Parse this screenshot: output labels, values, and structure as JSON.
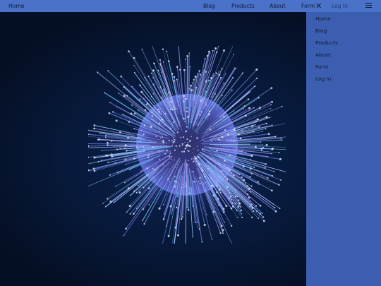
{
  "nav": {
    "home": "Home",
    "blog": "Blog",
    "products": "Products",
    "about": "About",
    "form": "Form",
    "login": "Log In",
    "close_icon": "close-icon",
    "menu_icon": "hamburger-menu-icon"
  },
  "drawer": {
    "items": [
      "Home",
      "Blog",
      "Products",
      "About",
      "Form",
      "Log In"
    ]
  },
  "colors": {
    "topbar": "#4a72c9",
    "drawer": "#3c5eb0",
    "background": "#06122a"
  },
  "hero": {
    "image": "sea-urchin-photo"
  }
}
